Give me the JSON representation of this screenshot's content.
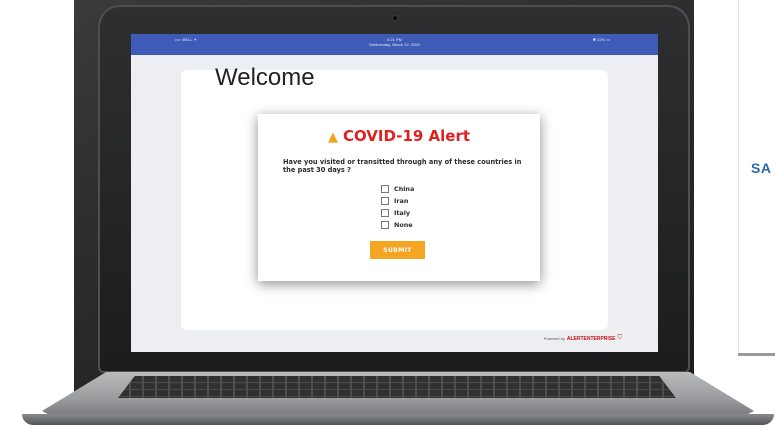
{
  "side_text": "SA",
  "status_bar": {
    "left": "•••○ BELL ✦",
    "time": "4:21 PM",
    "date": "Wednesday, March 12, 2020",
    "right": "✱ 22% ▭"
  },
  "background_heading": "Welcome",
  "alert": {
    "title": "COVID-19 Alert",
    "question": "Have you visited or transitted through any of these countries in the past 30 days ?",
    "options": [
      {
        "label": "China",
        "checked": false
      },
      {
        "label": "Iran",
        "checked": false
      },
      {
        "label": "Italy",
        "checked": false
      },
      {
        "label": "None",
        "checked": false
      }
    ],
    "submit_label": "SUBMIT"
  },
  "footer": {
    "powered_by": "Powered by",
    "brand": "ALERTENTERPRISE"
  },
  "colors": {
    "status_bar": "#3f5bb8",
    "alert_title": "#e01f1f",
    "warning_icon": "#f0a21b",
    "submit_button": "#f4a623",
    "side_text": "#2b6aa8",
    "brand": "#c0151b"
  }
}
